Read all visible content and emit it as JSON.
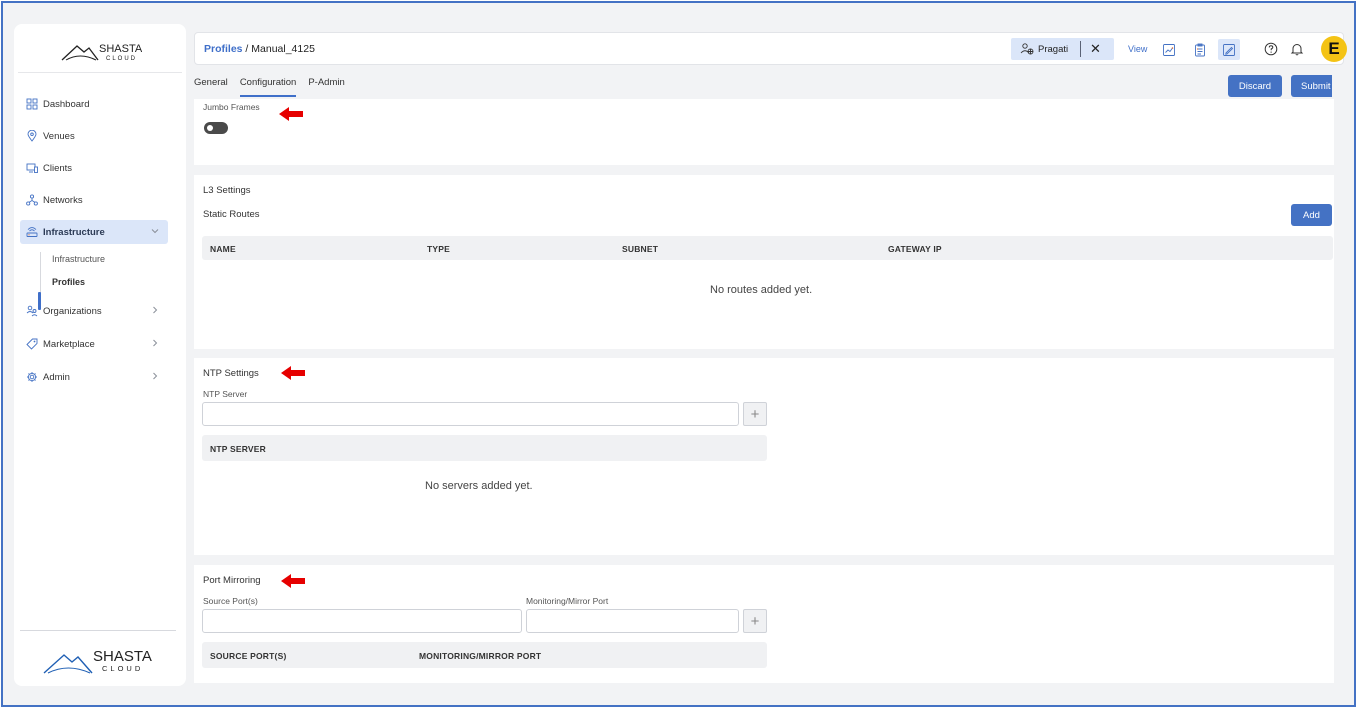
{
  "brand": {
    "logo_text": "SHASTA",
    "logo_sub": "CLOUD"
  },
  "sidebar": {
    "items": [
      {
        "label": "Dashboard",
        "icon": "dashboard-icon"
      },
      {
        "label": "Venues",
        "icon": "location-pin-icon"
      },
      {
        "label": "Clients",
        "icon": "devices-icon"
      },
      {
        "label": "Networks",
        "icon": "network-icon"
      },
      {
        "label": "Infrastructure",
        "icon": "router-icon"
      },
      {
        "label": "Organizations",
        "icon": "organizations-icon"
      },
      {
        "label": "Marketplace",
        "icon": "tag-icon"
      },
      {
        "label": "Admin",
        "icon": "gear-icon"
      }
    ],
    "sub_items": [
      {
        "label": "Infrastructure"
      },
      {
        "label": "Profiles"
      }
    ]
  },
  "header": {
    "breadcrumb_link": "Profiles",
    "breadcrumb_sep": " / ",
    "breadcrumb_current": "Manual_4125",
    "user_name": "Pragati",
    "view_label": "View",
    "avatar_letter": "E"
  },
  "tabs": [
    {
      "label": "General"
    },
    {
      "label": "Configuration"
    },
    {
      "label": "P-Admin"
    }
  ],
  "actions": {
    "discard": "Discard",
    "submit": "Submit"
  },
  "jumbo": {
    "label": "Jumbo Frames",
    "enabled": false
  },
  "l3": {
    "title": "L3 Settings",
    "static_routes": "Static Routes",
    "add_label": "Add",
    "columns": [
      "NAME",
      "TYPE",
      "SUBNET",
      "GATEWAY IP"
    ],
    "empty": "No routes added yet."
  },
  "ntp": {
    "title": "NTP Settings",
    "server_label": "NTP Server",
    "server_value": "",
    "column": "NTP SERVER",
    "empty": "No servers added yet."
  },
  "mirror": {
    "title": "Port Mirroring",
    "source_label": "Source Port(s)",
    "monitor_label": "Monitoring/Mirror Port",
    "columns": [
      "SOURCE PORT(S)",
      "MONITORING/MIRROR PORT"
    ]
  },
  "colors": {
    "accent": "#4472c4",
    "highlight": "#dbe6f9",
    "arrow": "#e60000",
    "avatar": "#f4c315"
  }
}
